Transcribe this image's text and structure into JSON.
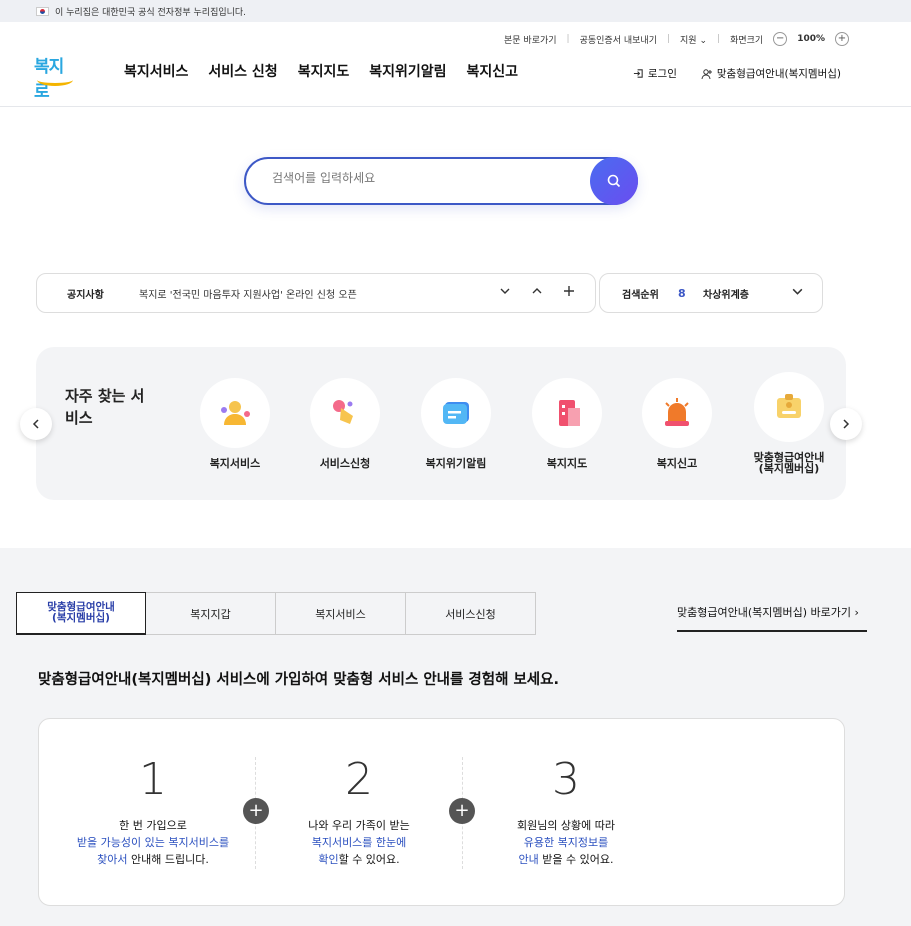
{
  "gov_bar": {
    "text": "이 누리집은 대한민국 공식 전자정부 누리집입니다."
  },
  "util": {
    "skip": "본문 바로가기",
    "cert": "공동인증서 내보내기",
    "support": "지원",
    "zoom_label": "화면크기",
    "zoom_minus": "−",
    "zoom_value": "100%",
    "zoom_plus": "+"
  },
  "logo": {
    "text": "복지로"
  },
  "gnb": [
    "복지서비스",
    "서비스 신청",
    "복지지도",
    "복지위기알림",
    "복지신고"
  ],
  "account": {
    "login": "로그인",
    "membership": "맞춤형급여안내(복지멤버십)"
  },
  "search": {
    "placeholder": "검색어를 입력하세요"
  },
  "notice": {
    "label": "공지사항",
    "message": "복지로 '전국민 마음투자 지원사업' 온라인 신청 오픈",
    "down": "⌄",
    "up": "⌃",
    "add": "+"
  },
  "rank": {
    "label": "검색순위",
    "number": "8",
    "word": "차상위계층",
    "chev": "⌄"
  },
  "favorites": {
    "title": "자주 찾는 서비스",
    "prev": "‹",
    "next": "›",
    "items": [
      {
        "label": "복지서비스",
        "icon": "people-icon"
      },
      {
        "label": "서비스신청",
        "icon": "hand-click-icon"
      },
      {
        "label": "복지위기알림",
        "icon": "chat-icon"
      },
      {
        "label": "복지지도",
        "icon": "building-icon"
      },
      {
        "label": "복지신고",
        "icon": "siren-icon"
      },
      {
        "label": "맞춤형급여안내\n(복지멤버십)",
        "icon": "id-card-icon"
      }
    ]
  },
  "tabs": [
    {
      "label": "맞춤형급여안내\n(복지멤버십)",
      "active": true
    },
    {
      "label": "복지지갑",
      "active": false
    },
    {
      "label": "복지서비스",
      "active": false
    },
    {
      "label": "서비스신청",
      "active": false
    }
  ],
  "shortcut": "맞춤형급여안내(복지멤버십) 바로가기 ›",
  "headline": "맞춤형급여안내(복지멤버십) 서비스에 가입하여 맞춤형 서비스 안내를 경험해 보세요.",
  "steps": [
    {
      "num": "1",
      "line1": "한 번 가입으로",
      "hl1": "받을 가능성이 있는 복지서비스를",
      "hl2": "찾아서",
      "rest": " 안내해 드립니다."
    },
    {
      "num": "2",
      "line1": "나와 우리 가족이 받는",
      "hl1": "복지서비스를 한눈에",
      "hl2": "확인",
      "rest": "할 수 있어요."
    },
    {
      "num": "3",
      "line1": "회원님의 상황에 따라",
      "hl1": "유용한 복지정보를",
      "hl2": "안내",
      "rest": " 받을 수 있어요."
    }
  ],
  "plus_sign": "+",
  "colors": {
    "accent": "#3d58c6",
    "highlight": "#2a4fbf",
    "logo": "#2aa7e0"
  }
}
